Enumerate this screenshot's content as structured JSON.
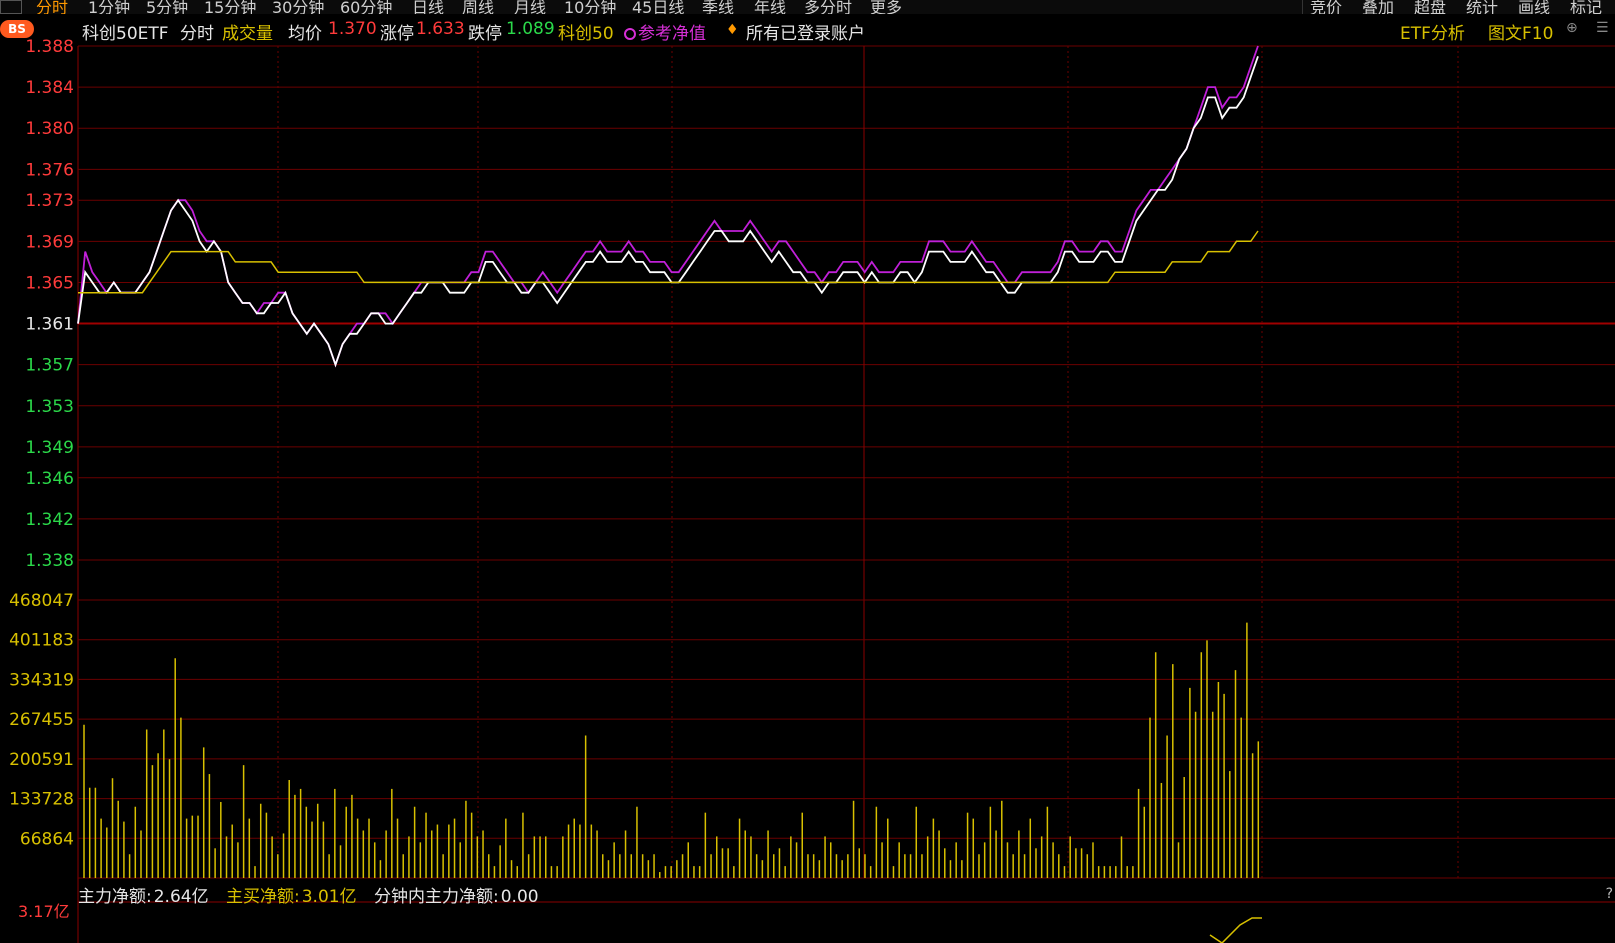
{
  "top_tabs": [
    "分时",
    "1分钟",
    "5分钟",
    "15分钟",
    "30分钟",
    "60分钟",
    "日线",
    "周线",
    "月线",
    "10分钟",
    "45日线",
    "季线",
    "年线",
    "多分时",
    "更多"
  ],
  "top_tools": [
    "竞价",
    "叠加",
    "超盘",
    "统计",
    "画线",
    "标记"
  ],
  "info": {
    "name": "科创50ETF",
    "tab_fenshi": "分时",
    "volume": "成交量",
    "avg_label": "均价",
    "avg_value": "1.370",
    "up_limit_label": "涨停",
    "up_limit_value": "1.633",
    "down_limit_label": "跌停",
    "down_limit_value": "1.089",
    "index_name": "科创50",
    "ref_nav": "参考净值",
    "accounts": "所有已登录账户",
    "etf_analysis": "ETF分析",
    "f10": "图文F10",
    "badge": "BS"
  },
  "colors": {
    "price": "#ffffff",
    "nav": "#c020d8",
    "avg": "#d8c000",
    "vol": "#d8c000",
    "grid": "#6b0000",
    "up": "#ff3b3b",
    "down": "#2bd94a"
  },
  "chart_data": {
    "type": "line",
    "price_ticks": [
      1.388,
      1.384,
      1.38,
      1.376,
      1.373,
      1.369,
      1.365,
      1.361,
      1.357,
      1.353,
      1.349,
      1.346,
      1.342,
      1.338
    ],
    "price_tick_labels": [
      "1.388",
      "1.384",
      "1.380",
      "1.376",
      "1.373",
      "1.369",
      "1.365",
      "1.361",
      "1.357",
      "1.353",
      "1.349",
      "1.346",
      "1.342",
      "1.338"
    ],
    "ylim": [
      1.338,
      1.388
    ],
    "prev_close": 1.361,
    "volume_ticks": [
      468047,
      401183,
      334319,
      267455,
      200591,
      133728,
      66864
    ],
    "volume_tick_labels": [
      "468047",
      "401183",
      "334319",
      "267455",
      "200591",
      "133728",
      "66864"
    ],
    "series": [
      {
        "values": [
          1.361,
          1.366,
          1.365,
          1.364,
          1.364,
          1.365,
          1.364,
          1.364,
          1.364,
          1.365,
          1.366,
          1.368,
          1.37,
          1.372,
          1.373,
          1.372,
          1.371,
          1.369,
          1.368,
          1.369,
          1.368,
          1.365,
          1.364,
          1.363,
          1.363,
          1.362,
          1.362,
          1.363,
          1.363,
          1.364,
          1.362,
          1.361,
          1.36,
          1.361,
          1.36,
          1.359,
          1.357,
          1.359,
          1.36,
          1.36,
          1.361,
          1.362,
          1.362,
          1.361,
          1.361,
          1.362,
          1.363,
          1.364,
          1.364,
          1.365,
          1.365,
          1.365,
          1.364,
          1.364,
          1.364,
          1.365,
          1.365,
          1.367,
          1.367,
          1.366,
          1.365,
          1.365,
          1.364,
          1.364,
          1.365,
          1.365,
          1.364,
          1.363,
          1.364,
          1.365,
          1.366,
          1.367,
          1.367,
          1.368,
          1.367,
          1.367,
          1.367,
          1.368,
          1.367,
          1.367,
          1.366,
          1.366,
          1.366,
          1.365,
          1.365,
          1.366,
          1.367,
          1.368,
          1.369,
          1.37,
          1.37,
          1.369,
          1.369,
          1.369,
          1.37,
          1.369,
          1.368,
          1.367,
          1.368,
          1.367,
          1.366,
          1.366,
          1.365,
          1.365,
          1.364,
          1.365,
          1.365,
          1.366,
          1.366,
          1.366,
          1.365,
          1.366,
          1.365,
          1.365,
          1.365,
          1.366,
          1.366,
          1.365,
          1.366,
          1.368,
          1.368,
          1.368,
          1.367,
          1.367,
          1.367,
          1.368,
          1.367,
          1.366,
          1.366,
          1.365,
          1.364,
          1.364,
          1.365,
          1.365,
          1.365,
          1.365,
          1.365,
          1.366,
          1.368,
          1.368,
          1.367,
          1.367,
          1.367,
          1.368,
          1.368,
          1.367,
          1.367,
          1.369,
          1.371,
          1.372,
          1.373,
          1.374,
          1.374,
          1.375,
          1.377,
          1.378,
          1.38,
          1.381,
          1.383,
          1.383,
          1.381,
          1.382,
          1.382,
          1.383,
          1.385,
          1.387
        ]
      },
      {
        "values": [
          1.361,
          1.368,
          1.366,
          1.365,
          1.364,
          1.365,
          1.364,
          1.364,
          1.364,
          1.365,
          1.366,
          1.368,
          1.37,
          1.372,
          1.373,
          1.373,
          1.372,
          1.37,
          1.369,
          1.369,
          1.368,
          1.365,
          1.364,
          1.363,
          1.363,
          1.362,
          1.363,
          1.363,
          1.364,
          1.364,
          1.362,
          1.361,
          1.36,
          1.361,
          1.36,
          1.359,
          1.357,
          1.359,
          1.36,
          1.361,
          1.361,
          1.362,
          1.362,
          1.362,
          1.361,
          1.362,
          1.363,
          1.364,
          1.365,
          1.365,
          1.365,
          1.365,
          1.365,
          1.365,
          1.365,
          1.366,
          1.366,
          1.368,
          1.368,
          1.367,
          1.366,
          1.365,
          1.365,
          1.364,
          1.365,
          1.366,
          1.365,
          1.364,
          1.365,
          1.366,
          1.367,
          1.368,
          1.368,
          1.369,
          1.368,
          1.368,
          1.368,
          1.369,
          1.368,
          1.368,
          1.367,
          1.367,
          1.367,
          1.366,
          1.366,
          1.367,
          1.368,
          1.369,
          1.37,
          1.371,
          1.37,
          1.37,
          1.37,
          1.37,
          1.371,
          1.37,
          1.369,
          1.368,
          1.369,
          1.369,
          1.368,
          1.367,
          1.366,
          1.366,
          1.365,
          1.366,
          1.366,
          1.367,
          1.367,
          1.367,
          1.366,
          1.367,
          1.366,
          1.366,
          1.366,
          1.367,
          1.367,
          1.367,
          1.367,
          1.369,
          1.369,
          1.369,
          1.368,
          1.368,
          1.368,
          1.369,
          1.368,
          1.367,
          1.367,
          1.366,
          1.365,
          1.365,
          1.366,
          1.366,
          1.366,
          1.366,
          1.366,
          1.367,
          1.369,
          1.369,
          1.368,
          1.368,
          1.368,
          1.369,
          1.369,
          1.368,
          1.368,
          1.37,
          1.372,
          1.373,
          1.374,
          1.374,
          1.375,
          1.376,
          1.377,
          1.378,
          1.38,
          1.382,
          1.384,
          1.384,
          1.382,
          1.383,
          1.383,
          1.384,
          1.386,
          1.388
        ]
      },
      {
        "values": [
          1.364,
          1.364,
          1.364,
          1.364,
          1.364,
          1.364,
          1.364,
          1.364,
          1.364,
          1.364,
          1.365,
          1.366,
          1.367,
          1.368,
          1.368,
          1.368,
          1.368,
          1.368,
          1.368,
          1.368,
          1.368,
          1.368,
          1.367,
          1.367,
          1.367,
          1.367,
          1.367,
          1.367,
          1.366,
          1.366,
          1.366,
          1.366,
          1.366,
          1.366,
          1.366,
          1.366,
          1.366,
          1.366,
          1.366,
          1.366,
          1.365,
          1.365,
          1.365,
          1.365,
          1.365,
          1.365,
          1.365,
          1.365,
          1.365,
          1.365,
          1.365,
          1.365,
          1.365,
          1.365,
          1.365,
          1.365,
          1.365,
          1.365,
          1.365,
          1.365,
          1.365,
          1.365,
          1.365,
          1.365,
          1.365,
          1.365,
          1.365,
          1.365,
          1.365,
          1.365,
          1.365,
          1.365,
          1.365,
          1.365,
          1.365,
          1.365,
          1.365,
          1.365,
          1.365,
          1.365,
          1.365,
          1.365,
          1.365,
          1.365,
          1.365,
          1.365,
          1.365,
          1.365,
          1.365,
          1.365,
          1.365,
          1.365,
          1.365,
          1.365,
          1.365,
          1.365,
          1.365,
          1.365,
          1.365,
          1.365,
          1.365,
          1.365,
          1.365,
          1.365,
          1.365,
          1.365,
          1.365,
          1.365,
          1.365,
          1.365,
          1.365,
          1.365,
          1.365,
          1.365,
          1.365,
          1.365,
          1.365,
          1.365,
          1.365,
          1.365,
          1.365,
          1.365,
          1.365,
          1.365,
          1.365,
          1.365,
          1.365,
          1.365,
          1.365,
          1.365,
          1.365,
          1.365,
          1.365,
          1.365,
          1.365,
          1.365,
          1.365,
          1.365,
          1.365,
          1.365,
          1.365,
          1.365,
          1.365,
          1.365,
          1.365,
          1.366,
          1.366,
          1.366,
          1.366,
          1.366,
          1.366,
          1.366,
          1.366,
          1.367,
          1.367,
          1.367,
          1.367,
          1.367,
          1.368,
          1.368,
          1.368,
          1.368,
          1.369,
          1.369,
          1.369,
          1.37
        ]
      }
    ],
    "volume": [
      258000,
      152000,
      152000,
      100000,
      85000,
      168000,
      130000,
      95000,
      40000,
      120000,
      80000,
      250000,
      190000,
      210000,
      250000,
      200000,
      370000,
      270000,
      100000,
      105000,
      105000,
      220000,
      175000,
      50000,
      128000,
      70000,
      90000,
      60000,
      190000,
      100000,
      20000,
      125000,
      110000,
      70000,
      40000,
      75000,
      165000,
      140000,
      150000,
      120000,
      95000,
      125000,
      95000,
      40000,
      150000,
      55000,
      120000,
      140000,
      100000,
      80000,
      100000,
      60000,
      30000,
      80000,
      150000,
      100000,
      40000,
      70000,
      120000,
      60000,
      110000,
      80000,
      90000,
      40000,
      90000,
      100000,
      60000,
      130000,
      110000,
      70000,
      80000,
      40000,
      20000,
      55000,
      100000,
      30000,
      20000,
      110000,
      40000,
      70000,
      70000,
      70000,
      20000,
      20000,
      70000,
      90000,
      100000,
      90000,
      240000,
      90000,
      80000,
      40000,
      30000,
      60000,
      40000,
      80000,
      40000,
      120000,
      40000,
      30000,
      40000,
      10000,
      20000,
      20000,
      30000,
      40000,
      60000,
      20000,
      20000,
      110000,
      40000,
      70000,
      50000,
      50000,
      20000,
      100000,
      80000,
      70000,
      40000,
      30000,
      80000,
      40000,
      50000,
      20000,
      70000,
      60000,
      110000,
      40000,
      40000,
      30000,
      70000,
      60000,
      40000,
      30000,
      40000,
      130000,
      50000,
      40000,
      20000,
      120000,
      60000,
      100000,
      20000,
      60000,
      40000,
      40000,
      120000,
      40000,
      70000,
      100000,
      80000,
      50000,
      30000,
      60000,
      30000,
      110000,
      100000,
      40000,
      60000,
      120000,
      80000,
      130000,
      60000,
      40000,
      80000,
      40000,
      100000,
      50000,
      70000,
      120000,
      60000,
      40000,
      20000,
      70000,
      50000,
      50000,
      40000,
      60000,
      20000,
      20000,
      20000,
      20000,
      70000,
      20000,
      20000,
      150000,
      120000,
      270000,
      380000,
      160000,
      240000,
      360000,
      60000,
      170000,
      320000,
      280000,
      380000,
      400000,
      280000,
      330000,
      310000,
      180000,
      350000,
      270000,
      430000,
      210000,
      230000
    ],
    "bottom": {
      "main_net_label": "主力净额:",
      "main_net_value": "2.64亿",
      "main_buy_label": "主买净额:",
      "main_buy_value": "3.01亿",
      "minute_net_label": "分钟内主力净额:",
      "minute_net_value": "0.00",
      "cap_label": "3.17亿"
    }
  }
}
